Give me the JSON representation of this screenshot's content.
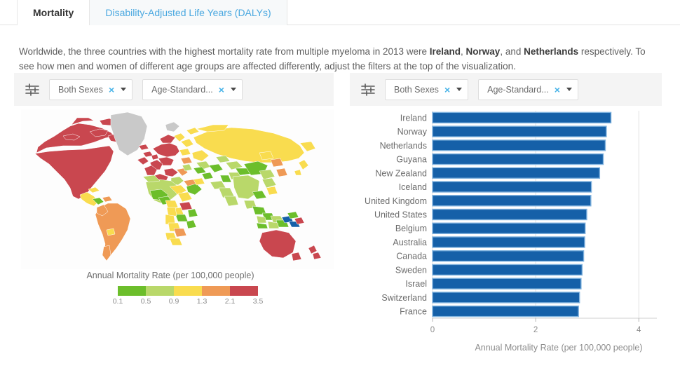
{
  "tabs": [
    {
      "label": "Mortality",
      "active": true
    },
    {
      "label": "Disability-Adjusted Life Years (DALYs)",
      "active": false
    }
  ],
  "intro": {
    "part1": "Worldwide, the three countries with the highest mortality rate from multiple myeloma in 2013 were ",
    "b1": "Ireland",
    "sep1": ", ",
    "b2": "Norway",
    "sep2": ", and ",
    "b3": "Netherlands",
    "part2": " respectively. To see how men and women of different age groups are affected differently, adjust the filters at the top of the visualization."
  },
  "filters": {
    "icon": "tune-filter-icon",
    "left": {
      "sex_chip": "Both Sexes",
      "metric_chip": "Age-Standard...",
      "clear_glyph": "×"
    },
    "right": {
      "sex_chip": "Both Sexes",
      "metric_chip": "Age-Standard...",
      "clear_glyph": "×"
    }
  },
  "map": {
    "legend_title": "Annual Mortality Rate (per 100,000 people)",
    "legend_colors": [
      "#6cbe2b",
      "#b9d86a",
      "#f9dc4f",
      "#ef9a56",
      "#c9474f"
    ],
    "legend_ticks": [
      "0.1",
      "0.5",
      "0.9",
      "1.3",
      "2.1",
      "3.5"
    ],
    "no_data_color": "#c9c9c9",
    "background": "#fdfdfd"
  },
  "chart_data": {
    "type": "bar",
    "orientation": "horizontal",
    "title": "",
    "xlabel": "Annual Mortality Rate (per 100,000 people)",
    "ylabel": "",
    "xlim": [
      0,
      4.35
    ],
    "xticks": [
      0,
      2,
      4
    ],
    "xtick_labels": [
      "0",
      "2",
      "4"
    ],
    "grid": true,
    "bar_color": "#1560a8",
    "bar_edge_color": "#7fb2de",
    "categories": [
      "Ireland",
      "Norway",
      "Netherlands",
      "Guyana",
      "New Zealand",
      "Iceland",
      "United Kingdom",
      "United States",
      "Belgium",
      "Australia",
      "Canada",
      "Sweden",
      "Israel",
      "Switzerland",
      "France"
    ],
    "values": [
      3.46,
      3.37,
      3.35,
      3.31,
      3.24,
      3.08,
      3.07,
      2.99,
      2.96,
      2.95,
      2.93,
      2.9,
      2.88,
      2.85,
      2.83
    ]
  }
}
